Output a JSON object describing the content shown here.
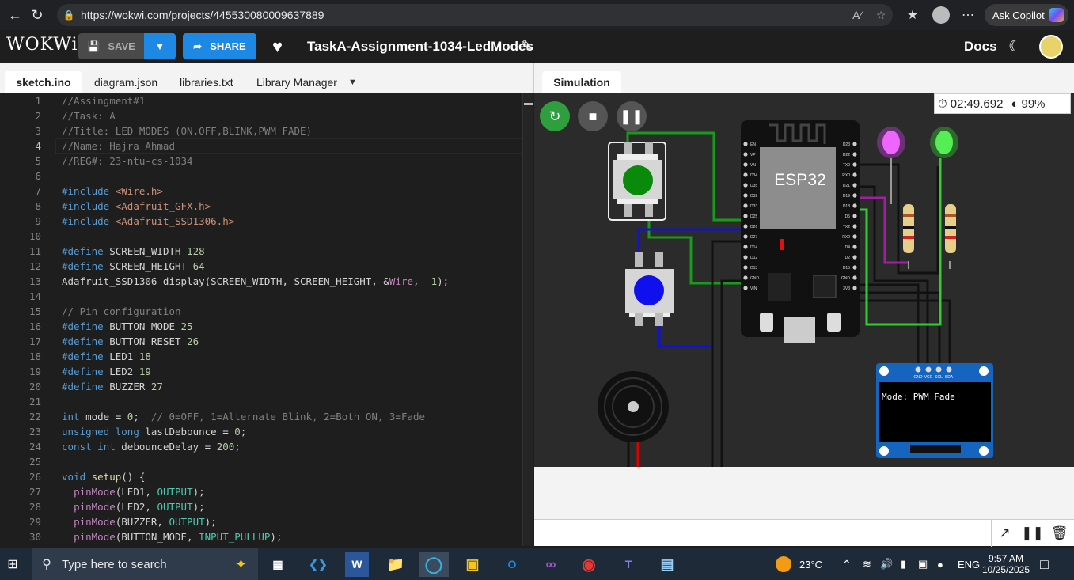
{
  "browser": {
    "url": "https://wokwi.com/projects/445530080009637889",
    "copilot_label": "Ask Copilot",
    "icons": [
      "back-icon",
      "refresh-icon",
      "lock-icon",
      "read-aloud-icon",
      "favorite-icon",
      "collections-icon",
      "profile-icon",
      "more-icon"
    ]
  },
  "header": {
    "logo": "WOKWi",
    "save_label": "SAVE",
    "share_label": "SHARE",
    "project_title": "TaskA-Assignment-1034-LedModes",
    "docs_label": "Docs"
  },
  "editor": {
    "tabs": [
      "sketch.ino",
      "diagram.json",
      "libraries.txt",
      "Library Manager"
    ],
    "active_tab": "sketch.ino",
    "current_line": 4,
    "lines": [
      "//Assingment#1",
      "//Task: A",
      "//Title: LED MODES (ON,OFF,BLINK,PWM FADE)",
      "//Name: Hajra Ahmad",
      "//REG#: 23-ntu-cs-1034",
      "",
      "#include <Wire.h>",
      "#include <Adafruit_GFX.h>",
      "#include <Adafruit_SSD1306.h>",
      "",
      "#define SCREEN_WIDTH 128",
      "#define SCREEN_HEIGHT 64",
      "Adafruit_SSD1306 display(SCREEN_WIDTH, SCREEN_HEIGHT, &Wire, -1);",
      "",
      "// Pin configuration",
      "#define BUTTON_MODE 25",
      "#define BUTTON_RESET 26",
      "#define LED1 18",
      "#define LED2 19",
      "#define BUZZER 27",
      "",
      "int mode = 0;  // 0=OFF, 1=Alternate Blink, 2=Both ON, 3=Fade",
      "unsigned long lastDebounce = 0;",
      "const int debounceDelay = 200;",
      "",
      "void setup() {",
      "  pinMode(LED1, OUTPUT);",
      "  pinMode(LED2, OUTPUT);",
      "  pinMode(BUZZER, OUTPUT);",
      "  pinMode(BUTTON_MODE, INPUT_PULLUP);"
    ]
  },
  "simulation": {
    "tab_label": "Simulation",
    "timer": "02:49.692",
    "speed": "99%",
    "mcu_label": "ESP32",
    "oled_text": "Mode: PWM Fade",
    "oled_pins": [
      "GND",
      "VCC",
      "SCL",
      "SDA"
    ],
    "esp_left_pins": [
      "EN",
      "VP",
      "VN",
      "D34",
      "D35",
      "D32",
      "D33",
      "D25",
      "D26",
      "D27",
      "D14",
      "D12",
      "D13",
      "GND",
      "VIN"
    ],
    "esp_right_pins": [
      "D23",
      "D22",
      "TX0",
      "RX0",
      "D21",
      "D19",
      "D18",
      "D5",
      "TX2",
      "RX2",
      "D4",
      "D2",
      "D15",
      "GND",
      "3V3"
    ],
    "led_colors": [
      "#e040fb",
      "#33dd33"
    ],
    "button_colors": [
      "#0a8a0a",
      "#1010ee"
    ]
  },
  "taskbar": {
    "search_placeholder": "Type here to search",
    "weather": "23°C",
    "language": "ENG",
    "time": "9:57 AM",
    "date": "10/25/2025"
  }
}
